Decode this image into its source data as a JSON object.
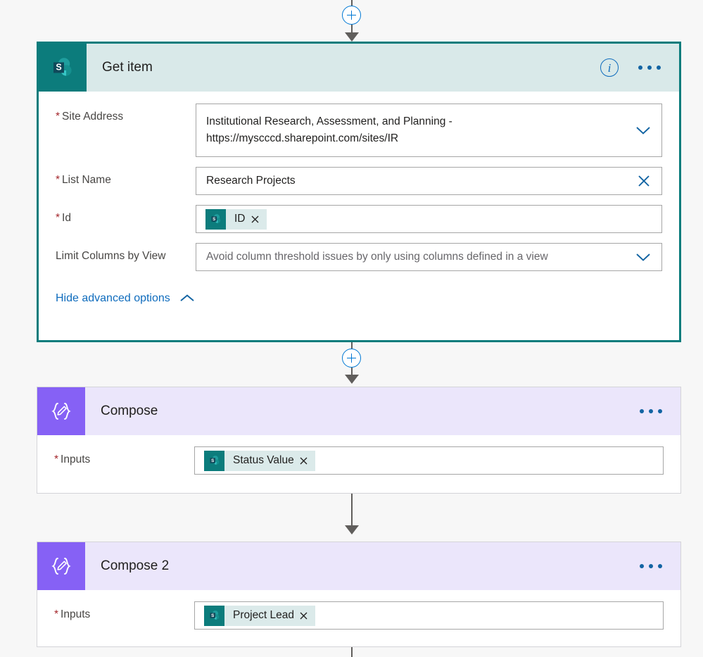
{
  "page": {
    "background": "#f7f7f7",
    "accent_teal": "#0c7c7c",
    "accent_purple": "#8661f5",
    "accent_blue": "#0f6cbd",
    "required_star_color": "#a4262c"
  },
  "connectors": [
    {
      "name": "connector-top",
      "has_plus": true,
      "plus_label": "+"
    },
    {
      "name": "connector-getitem-to-compose",
      "has_plus": true,
      "plus_label": "+"
    },
    {
      "name": "connector-compose-to-compose2",
      "has_plus": false,
      "plus_label": ""
    },
    {
      "name": "connector-bottom",
      "has_plus": false,
      "plus_label": ""
    }
  ],
  "cards": {
    "get_item": {
      "title": "Get item",
      "icon": "sharepoint-icon",
      "selected": true,
      "info_label": "i",
      "more_label": "...",
      "fields": [
        {
          "label": "Site Address",
          "required": true,
          "type": "dropdown",
          "value_line1": "Institutional Research, Assessment, and Planning -",
          "value_line2": "https://myscccd.sharepoint.com/sites/IR",
          "trailing_icon": "chevron-down-icon"
        },
        {
          "label": "List Name",
          "required": true,
          "type": "text",
          "value": "Research Projects",
          "trailing_icon": "close-icon"
        },
        {
          "label": "Id",
          "required": true,
          "type": "token",
          "token": {
            "label": "ID",
            "icon": "sharepoint-icon",
            "remove_label": "x"
          }
        },
        {
          "label": "Limit Columns by View",
          "required": false,
          "type": "dropdown",
          "placeholder": "Avoid column threshold issues by only using columns defined in a view",
          "trailing_icon": "chevron-down-icon"
        }
      ],
      "advanced_options": {
        "label": "Hide advanced options",
        "icon": "chevron-up-icon"
      }
    },
    "compose": {
      "title": "Compose",
      "icon": "compose-icon",
      "more_label": "...",
      "fields": [
        {
          "label": "Inputs",
          "required": true,
          "type": "token",
          "token": {
            "label": "Status Value",
            "icon": "sharepoint-icon",
            "remove_label": "x"
          }
        }
      ]
    },
    "compose_2": {
      "title": "Compose 2",
      "icon": "compose-icon",
      "more_label": "...",
      "fields": [
        {
          "label": "Inputs",
          "required": true,
          "type": "token",
          "token": {
            "label": "Project Lead",
            "icon": "sharepoint-icon",
            "remove_label": "x"
          }
        }
      ]
    }
  }
}
